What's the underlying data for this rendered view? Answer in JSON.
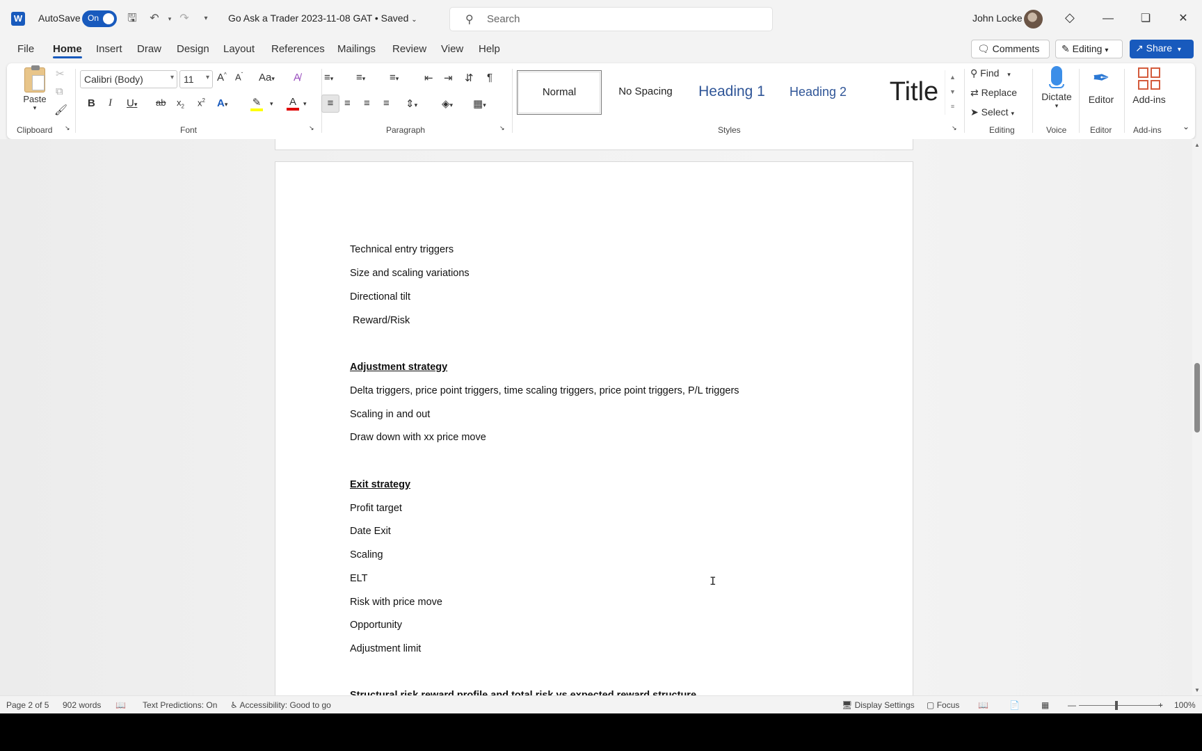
{
  "titlebar": {
    "app_icon": "W",
    "autosave_label": "AutoSave",
    "autosave_state": "On",
    "doc_title": "Go Ask a Trader 2023-11-08 GAT • Saved",
    "search_placeholder": "Search",
    "user_name": "John Locke"
  },
  "tabs": [
    "File",
    "Home",
    "Insert",
    "Draw",
    "Design",
    "Layout",
    "References",
    "Mailings",
    "Review",
    "View",
    "Help"
  ],
  "tab_buttons": {
    "comments": "Comments",
    "editing": "Editing",
    "share": "Share"
  },
  "ribbon": {
    "clipboard": {
      "paste": "Paste",
      "label": "Clipboard"
    },
    "font": {
      "name": "Calibri (Body)",
      "size": "11",
      "label": "Font"
    },
    "paragraph": {
      "label": "Paragraph"
    },
    "styles": {
      "label": "Styles",
      "items": [
        "Normal",
        "No Spacing",
        "Heading 1",
        "Heading 2",
        "Title"
      ]
    },
    "editing": {
      "find": "Find",
      "replace": "Replace",
      "select": "Select",
      "label": "Editing"
    },
    "voice": {
      "dictate": "Dictate",
      "label": "Voice"
    },
    "editor": {
      "editor": "Editor",
      "label": "Editor"
    },
    "addins": {
      "addins": "Add-ins",
      "label": "Add-ins"
    }
  },
  "document": {
    "lines": [
      {
        "text": "Technical entry triggers",
        "style": "normal"
      },
      {
        "text": "Size and scaling variations",
        "style": "normal"
      },
      {
        "text": "Directional tilt",
        "style": "normal"
      },
      {
        "text": " Reward/Risk",
        "style": "normal"
      },
      {
        "text": "Adjustment strategy",
        "style": "heading"
      },
      {
        "text": "Delta triggers, price point triggers, time scaling triggers, price point triggers, P/L triggers",
        "style": "normal"
      },
      {
        "text": "Scaling in and out",
        "style": "normal"
      },
      {
        "text": "Draw down with xx price move",
        "style": "normal"
      },
      {
        "text": "Exit strategy",
        "style": "heading"
      },
      {
        "text": "Profit target",
        "style": "normal"
      },
      {
        "text": "Date Exit",
        "style": "normal"
      },
      {
        "text": "Scaling",
        "style": "normal"
      },
      {
        "text": "ELT",
        "style": "normal"
      },
      {
        "text": "Risk with price move",
        "style": "normal"
      },
      {
        "text": "Opportunity",
        "style": "normal"
      },
      {
        "text": "Adjustment limit",
        "style": "normal"
      },
      {
        "text": "Structural risk reward profile and total risk vs expected reward structure",
        "style": "heading"
      }
    ]
  },
  "statusbar": {
    "page": "Page 2 of 5",
    "words": "902 words",
    "text_predictions": "Text Predictions: On",
    "accessibility": "Accessibility: Good to go",
    "display_settings": "Display Settings",
    "focus": "Focus",
    "zoom": "100%"
  },
  "colors": {
    "accent": "#185abd",
    "highlight": "#ffff00",
    "font_color": "#e00000"
  }
}
